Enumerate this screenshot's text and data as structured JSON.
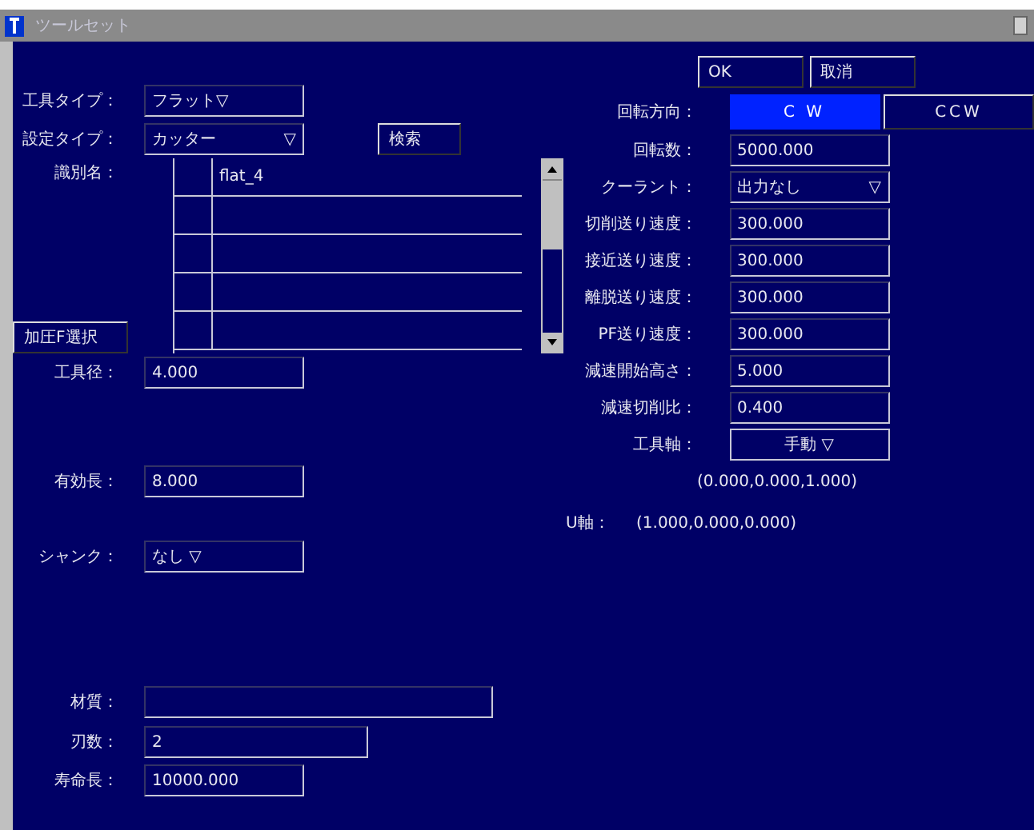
{
  "window": {
    "title": "ツールセット"
  },
  "dialog_buttons": [
    {
      "label": "OK"
    },
    {
      "label": "取消"
    }
  ],
  "left_fields": [
    {
      "kind": "dropdown",
      "label": "工具タイプ：",
      "value": "フラット▽"
    },
    {
      "kind": "dropdown_search",
      "label": "設定タイプ：",
      "value": "カッター",
      "arrow": "▽",
      "button": "検索"
    },
    {
      "kind": "list",
      "label": "識別名：",
      "rows": [
        "flat_4"
      ],
      "button": "加圧F選択"
    },
    {
      "kind": "text",
      "label": "工具径：",
      "value": "4.000"
    },
    {
      "kind": "text",
      "label": "有効長：",
      "value": "8.000"
    },
    {
      "kind": "dropdown",
      "label": "シャンク：",
      "value": "なし ▽"
    },
    {
      "kind": "text",
      "label": "材質："
    },
    {
      "kind": "text",
      "label": "刃数：",
      "value": "2"
    },
    {
      "kind": "text",
      "label": "寿命長：",
      "value": "10000.000"
    }
  ],
  "rotation": {
    "label": "回転方向：",
    "options": [
      {
        "label": "C W",
        "selected": true
      },
      {
        "label": "CCW",
        "selected": false
      }
    ]
  },
  "right_fields": [
    {
      "kind": "text",
      "label": "回転数：",
      "value": "5000.000"
    },
    {
      "kind": "dropdown",
      "label": "クーラント：",
      "value": "出力なし",
      "arrow": "▽"
    },
    {
      "kind": "text",
      "label": "切削送り速度：",
      "value": "300.000"
    },
    {
      "kind": "text",
      "label": "接近送り速度：",
      "value": "300.000"
    },
    {
      "kind": "text",
      "label": "離脱送り速度：",
      "value": "300.000"
    },
    {
      "kind": "text",
      "label": "PF送り速度：",
      "value": "300.000"
    },
    {
      "kind": "text",
      "label": "減速開始高さ：",
      "value": "5.000"
    },
    {
      "kind": "text",
      "label": "減速切削比：",
      "value": "0.400"
    },
    {
      "kind": "axis_dropdown",
      "label": "工具軸：",
      "value": "手動 ▽"
    }
  ],
  "tool_axis_vector": "(0.000,0.000,1.000)",
  "u_axis": {
    "label": "U軸：",
    "value": "(1.000,0.000,0.000)"
  }
}
